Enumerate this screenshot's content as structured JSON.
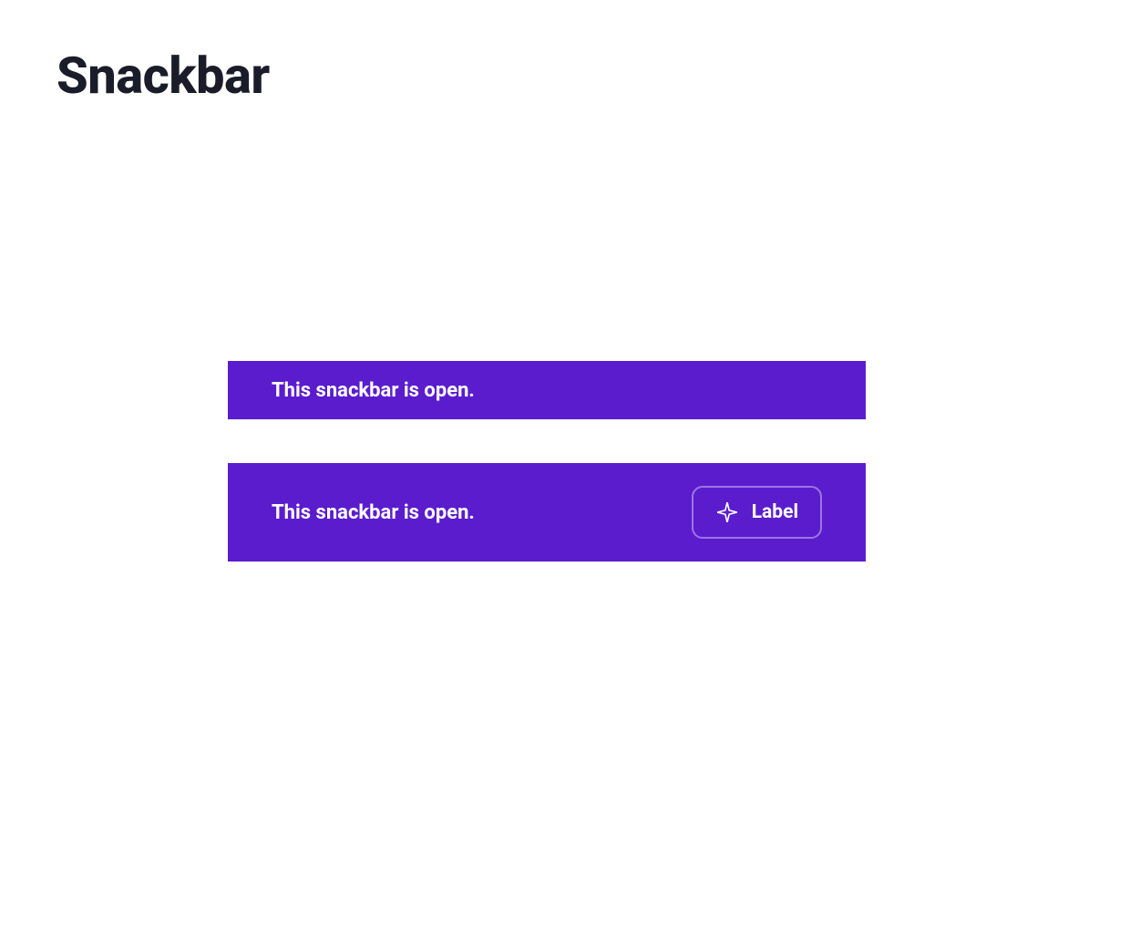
{
  "page": {
    "title": "Snackbar"
  },
  "snackbars": [
    {
      "message": "This snackbar is open."
    },
    {
      "message": "This snackbar is open.",
      "action_label": "Label"
    }
  ],
  "colors": {
    "primary": "#5b1cce",
    "text_dark": "#1a1d29",
    "white": "#ffffff"
  }
}
